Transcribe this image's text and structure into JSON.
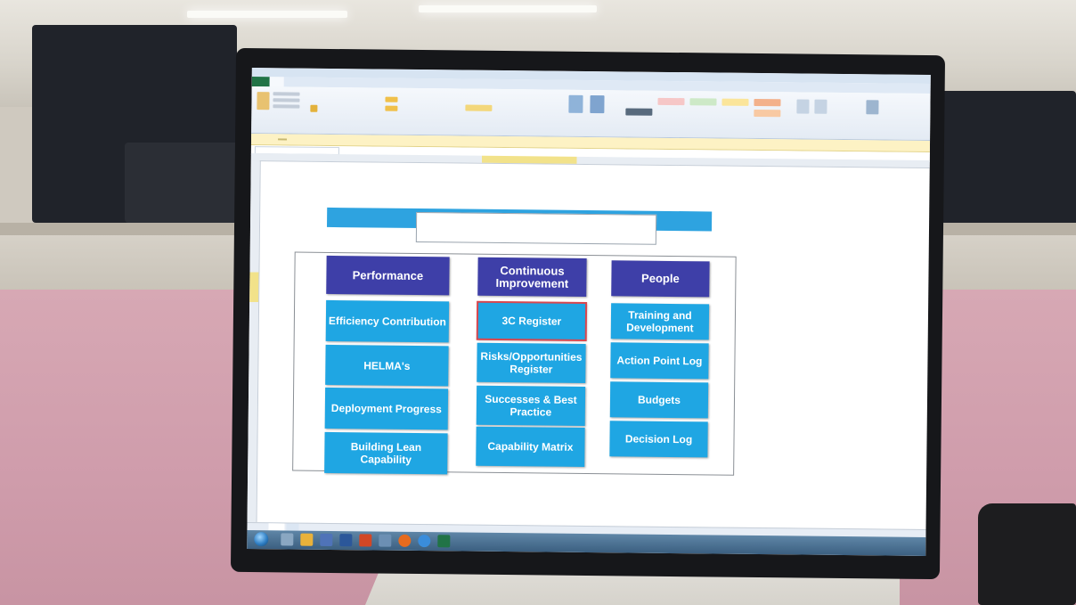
{
  "dashboard": {
    "headers": {
      "performance": "Performance",
      "continuous_improvement": "Continuous Improvement",
      "people": "People"
    },
    "performance_items": [
      "Efficiency Contribution",
      "HELMA's",
      "Deployment Progress",
      "Building Lean Capability"
    ],
    "ci_items": [
      "3C Register",
      "Risks/Opportunities Register",
      "Successes & Best Practice",
      "Capability Matrix"
    ],
    "people_items": [
      "Training and Development",
      "Action Point Log",
      "Budgets",
      "Decision Log"
    ]
  },
  "colors": {
    "header_button": "#3e3fa8",
    "item_button": "#1fa6e3",
    "banner": "#2ea3e0",
    "excel_green": "#217346",
    "wall_pink": "#d7a8b4"
  }
}
